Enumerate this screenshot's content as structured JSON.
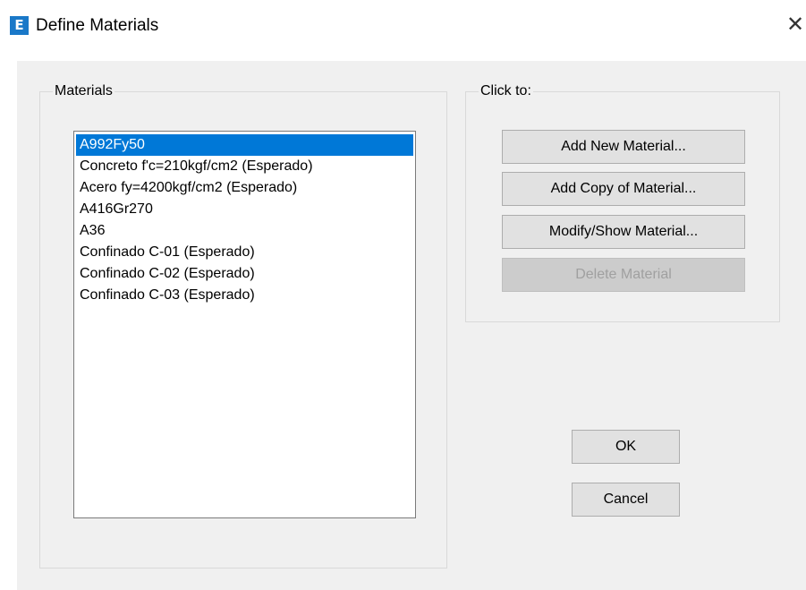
{
  "window": {
    "title": "Define Materials",
    "app_icon_letter": "E",
    "app_icon_color": "#1a78c8",
    "close_glyph": "✕"
  },
  "materials_group": {
    "legend": "Materials",
    "selected_index": 0,
    "items": [
      "A992Fy50",
      "Concreto f'c=210kgf/cm2 (Esperado)",
      "Acero fy=4200kgf/cm2 (Esperado)",
      "A416Gr270",
      "A36",
      "Confinado C-01 (Esperado)",
      "Confinado C-02 (Esperado)",
      "Confinado C-03 (Esperado)"
    ]
  },
  "click_to_group": {
    "legend": "Click to:",
    "add_new_label": "Add New Material...",
    "add_copy_label": "Add Copy of Material...",
    "modify_label": "Modify/Show Material...",
    "delete_label": "Delete Material",
    "delete_enabled": false
  },
  "footer": {
    "ok_label": "OK",
    "cancel_label": "Cancel"
  },
  "colors": {
    "selection": "#0078d7",
    "dialog_background": "#f0f0f0",
    "button_face": "#e1e1e1"
  }
}
